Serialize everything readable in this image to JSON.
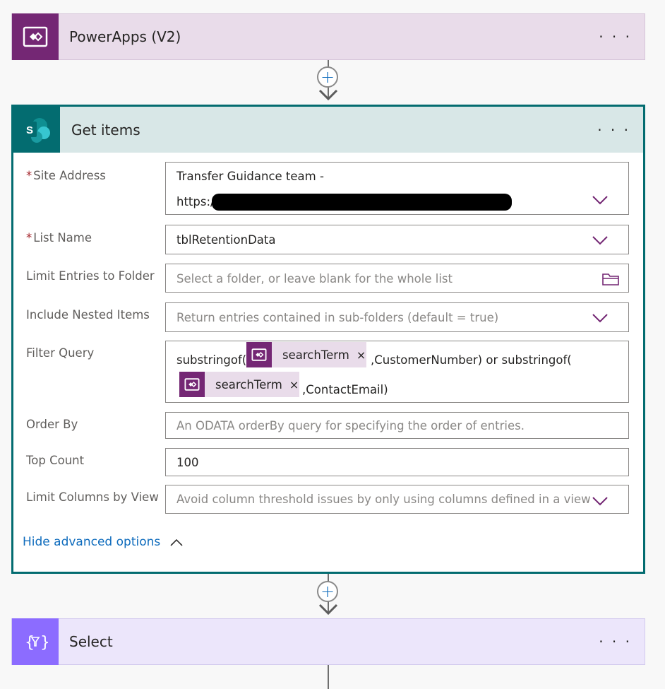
{
  "trigger": {
    "title": "PowerApps (V2)",
    "icon": "powerapps-icon",
    "color": "#742774"
  },
  "get_items": {
    "title": "Get items",
    "icon": "sharepoint-icon",
    "accent": "#036c70",
    "fields": {
      "site_address": {
        "label": "Site Address",
        "required_mark": "*",
        "line1": "Transfer Guidance team -",
        "line2": "https:/"
      },
      "list_name": {
        "label": "List Name",
        "required_mark": "*",
        "value": "tblRetentionData"
      },
      "limit_folder": {
        "label": "Limit Entries to Folder",
        "placeholder": "Select a folder, or leave blank for the whole list"
      },
      "nested": {
        "label": "Include Nested Items",
        "placeholder": "Return entries contained in sub-folders (default = true)"
      },
      "filter_query": {
        "label": "Filter Query",
        "text_start": "substringof(",
        "token1": "searchTerm",
        "text_mid": ",CustomerNumber) or substringof(",
        "token2": "searchTerm",
        "text_end": ",ContactEmail)",
        "token_remove": "×"
      },
      "order_by": {
        "label": "Order By",
        "placeholder": "An ODATA orderBy query for specifying the order of entries."
      },
      "top_count": {
        "label": "Top Count",
        "value": "100"
      },
      "limit_columns": {
        "label": "Limit Columns by View",
        "placeholder": "Avoid column threshold issues by only using columns defined in a view"
      }
    },
    "advanced_toggle": "Hide advanced options"
  },
  "select_action": {
    "title": "Select",
    "icon": "data-operation-icon",
    "color": "#8c6cff"
  },
  "more_label": "· · ·"
}
